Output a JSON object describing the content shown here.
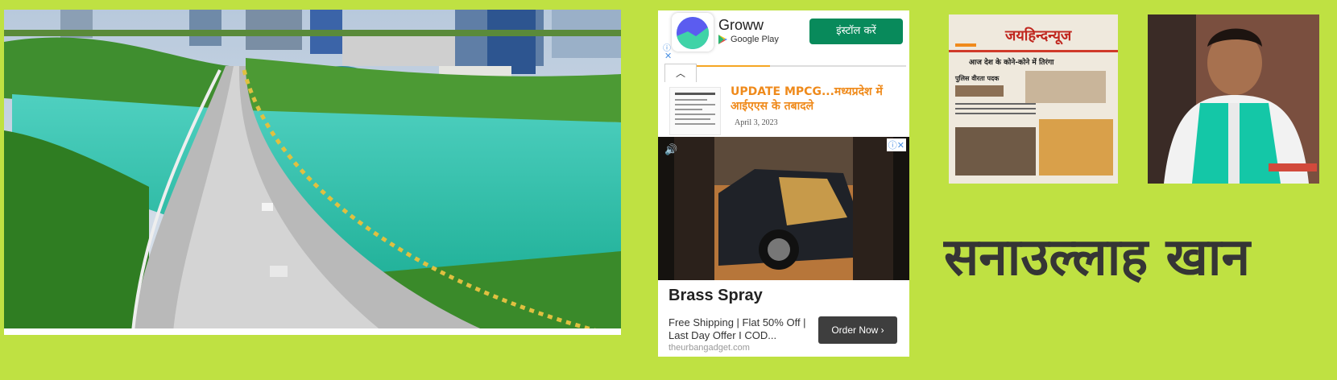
{
  "hero_photo": {
    "alt": ""
  },
  "ad_top": {
    "app_name": "Groww",
    "store_label": "Google Play",
    "install_label": "इंस्टॉल करें",
    "progress": 0.35
  },
  "article": {
    "title": "UPDATE MPCG...मध्यप्रदेश में आईएएस के तबादले",
    "date": "April 3, 2023"
  },
  "ad_bottom": {
    "headline": "Brass Spray",
    "description": "Free Shipping | Flat 50% Off | Last Day Offer I COD...",
    "domain": "theurbangadget.com",
    "cta_label": "Order Now"
  },
  "newspaper": {
    "masthead": "जयहिन्दन्यूज",
    "headline": "आज देश के कोने-कोने में तिरंगा",
    "subhead": "पुलिस वीरता पदक"
  },
  "profile": {
    "name": "सनाउल्लाह खान"
  },
  "colors": {
    "page_bg": "#bfe142",
    "install_green": "#088a5b",
    "article_orange": "#ef8a1b",
    "name_text": "#353535"
  }
}
